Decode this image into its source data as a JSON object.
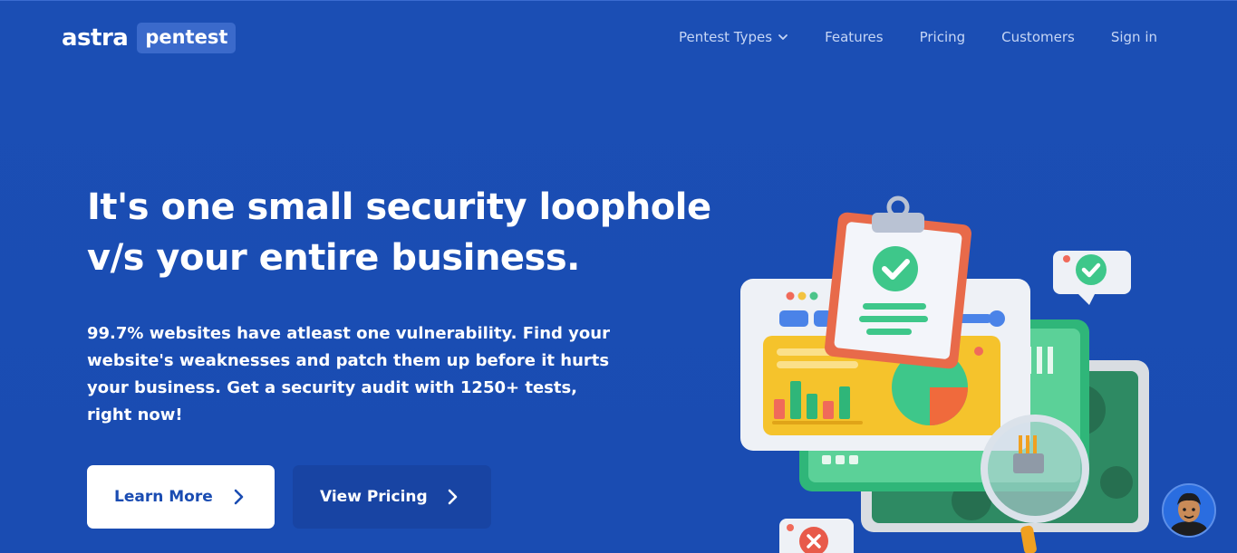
{
  "nav": {
    "logo_word": "astra",
    "logo_badge": "pentest",
    "links": [
      "Pentest Types",
      "Features",
      "Pricing",
      "Customers",
      "Sign in"
    ]
  },
  "hero": {
    "headline_line1": "It's one small security loophole",
    "headline_line2": "v/s your entire business.",
    "subtext": "99.7% websites have atleast one vulnerability. Find your website's weaknesses and patch them up before it hurts your business. Get a security audit with 1250+ tests, right now!",
    "learn_more": "Learn More",
    "view_pricing": "View Pricing"
  },
  "colors": {
    "background": "#1a4db3",
    "nav_link": "#c6d6f5",
    "logo_badge": "#3b6acb",
    "button_primary": "#ffffff",
    "button_secondary": "#1844a3"
  },
  "icons": {
    "dropdown": "chevron-down-icon",
    "button_arrow": "chevron-right-icon",
    "chat_avatar": "chat-avatar",
    "illustration": "security-dashboard-illustration"
  }
}
